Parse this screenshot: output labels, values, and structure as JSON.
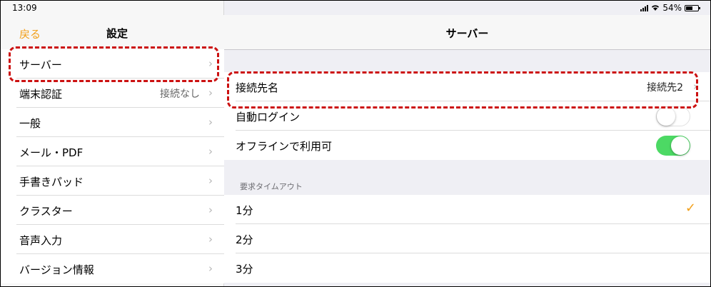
{
  "status_bar": {
    "time": "13:09",
    "battery": "54%",
    "battery_level": 0.54
  },
  "left_nav": {
    "back_label": "戻る",
    "title": "設定"
  },
  "left_items": [
    {
      "label": "サーバー",
      "value": ""
    },
    {
      "label": "端末認証",
      "value": "接続なし"
    },
    {
      "label": "一般",
      "value": ""
    },
    {
      "label": "メール・PDF",
      "value": ""
    },
    {
      "label": "手書きパッド",
      "value": ""
    },
    {
      "label": "クラスター",
      "value": ""
    },
    {
      "label": "音声入力",
      "value": ""
    },
    {
      "label": "バージョン情報",
      "value": ""
    }
  ],
  "right_nav": {
    "title": "サーバー"
  },
  "server_rows": {
    "connection": {
      "label": "接続先名",
      "value": "接続先2"
    },
    "auto_login": {
      "label": "自動ログイン",
      "on": false
    },
    "offline": {
      "label": "オフラインで利用可",
      "on": true
    }
  },
  "timeout_section": {
    "header": "要求タイムアウト",
    "options": [
      {
        "label": "1分",
        "selected": true
      },
      {
        "label": "2分",
        "selected": false
      },
      {
        "label": "3分",
        "selected": false
      }
    ]
  },
  "colors": {
    "accent": "#f2a01b",
    "toggle_on": "#4cd964",
    "highlight": "#cc1111"
  }
}
